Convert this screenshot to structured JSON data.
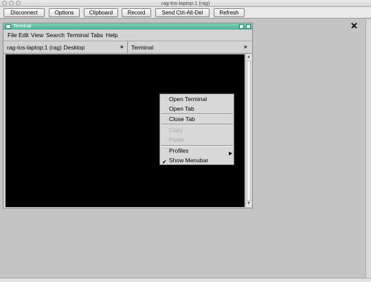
{
  "window": {
    "title": "rag-tos-laptop:1 (rag)"
  },
  "toolbar": {
    "buttons": [
      "Disconnect",
      "Options",
      "Clipboard",
      "Record",
      "Send Ctrl-Alt-Del",
      "Refresh"
    ]
  },
  "viewer": {
    "close_icon": "close-icon",
    "close_glyph": "✕"
  },
  "terminal": {
    "title": "Terminal",
    "menu": [
      "File",
      "Edit",
      "View",
      "Search",
      "Terminal",
      "Tabs",
      "Help"
    ],
    "tabs": [
      {
        "label": "rag-tos-laptop:1 (rag) Desktop",
        "close": "×"
      },
      {
        "label": "Terminal",
        "close": "×"
      }
    ]
  },
  "context_menu": {
    "items": [
      {
        "label": "Open Terminal",
        "enabled": true
      },
      {
        "label": "Open Tab",
        "enabled": true
      },
      {
        "label": "Close Tab",
        "enabled": true
      },
      {
        "label": "Copy",
        "enabled": false
      },
      {
        "label": "Paste",
        "enabled": false
      },
      {
        "label": "Profiles",
        "enabled": true,
        "submenu": true
      },
      {
        "label": "Show Menubar",
        "enabled": true,
        "checked": true
      }
    ],
    "submenu_arrow": "▶",
    "check_glyph": "✔"
  },
  "colors": {
    "terminal_bg": "#000000",
    "titlebar_accent": "#5fbba2"
  }
}
